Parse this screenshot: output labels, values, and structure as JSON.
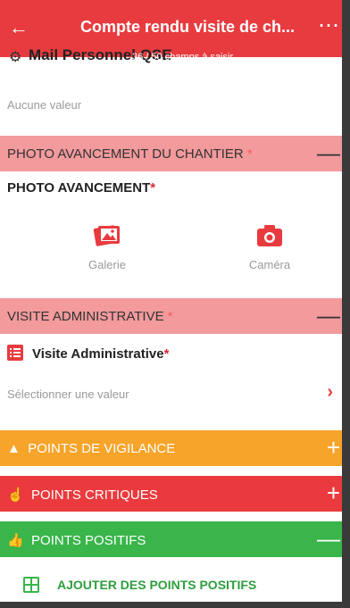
{
  "header": {
    "title": "Compte rendu visite de ch...",
    "counter": "36 / 50 champs à saisir",
    "back_icon": "←",
    "more_icon": "⋯"
  },
  "previous_field": {
    "label": "Mail Personnel QSE",
    "value": "Aucune valeur"
  },
  "photo_section": {
    "title": "PHOTO AVANCEMENT DU CHANTIER",
    "star": "*",
    "toggle": "—",
    "field_label": "PHOTO AVANCEMENT",
    "field_star": "*",
    "gallery_label": "Galerie",
    "camera_label": "Caméra"
  },
  "admin_section": {
    "title": "VISITE ADMINISTRATIVE",
    "star": "*",
    "toggle": "—",
    "field_label": "Visite Administrative",
    "field_star": "*",
    "placeholder": "Sélectionner une valeur",
    "chevron": "›"
  },
  "vigilance_section": {
    "title": "POINTS DE VIGILANCE",
    "toggle": "+"
  },
  "critical_section": {
    "title": "POINTS CRITIQUES",
    "toggle": "+"
  },
  "positive_section": {
    "title": "POINTS POSITIFS",
    "toggle": "—"
  },
  "add_positive": {
    "label": "AJOUTER DES POINTS POSITIFS"
  },
  "colors": {
    "primary_red": "#e83b3f",
    "section_pink": "#f29a9c",
    "vigilance_orange": "#f7a42a",
    "positive_green": "#39b54a"
  },
  "icons": {
    "back": "arrow-left-icon",
    "more": "more-dots-icon",
    "gallery": "gallery-icon",
    "camera": "camera-icon",
    "list": "list-icon",
    "warning": "warning-icon",
    "critical": "hand-icon",
    "thumbs_up": "thumbs-up-icon",
    "add_grid": "grid-plus-icon"
  }
}
